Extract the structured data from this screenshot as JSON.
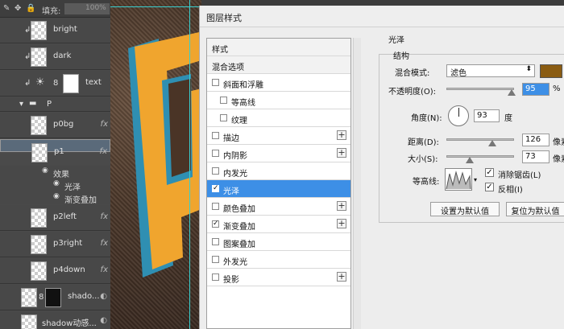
{
  "layers_panel": {
    "fill_label": "填充:",
    "fill_value": "100%",
    "layers": [
      {
        "name": "bright",
        "fx": ""
      },
      {
        "name": "dark",
        "fx": ""
      },
      {
        "name": "text",
        "fx": ""
      },
      {
        "name": "P",
        "fx": ""
      },
      {
        "name": "p0bg",
        "fx": "fx"
      },
      {
        "name": "p1",
        "fx": "fx"
      },
      {
        "name": "p2left",
        "fx": "fx"
      },
      {
        "name": "p3right",
        "fx": "fx"
      },
      {
        "name": "p4down",
        "fx": "fx"
      },
      {
        "name": "shado...",
        "fx": ""
      },
      {
        "name": "shadow动感...",
        "fx": ""
      }
    ],
    "effects_label": "效果",
    "effects": [
      "光泽",
      "渐变叠加"
    ]
  },
  "dialog": {
    "title": "图层样式",
    "styles_list": [
      {
        "label": "样式",
        "checkbox": false,
        "checked": false,
        "plus": false
      },
      {
        "label": "混合选项",
        "checkbox": false,
        "checked": false,
        "plus": false
      },
      {
        "label": "斜面和浮雕",
        "checkbox": true,
        "checked": false,
        "plus": false
      },
      {
        "label": "等高线",
        "checkbox": true,
        "checked": false,
        "plus": false
      },
      {
        "label": "纹理",
        "checkbox": true,
        "checked": false,
        "plus": false
      },
      {
        "label": "描边",
        "checkbox": true,
        "checked": false,
        "plus": true
      },
      {
        "label": "内阴影",
        "checkbox": true,
        "checked": false,
        "plus": true
      },
      {
        "label": "内发光",
        "checkbox": true,
        "checked": false,
        "plus": false
      },
      {
        "label": "光泽",
        "checkbox": true,
        "checked": true,
        "plus": false
      },
      {
        "label": "颜色叠加",
        "checkbox": true,
        "checked": false,
        "plus": true
      },
      {
        "label": "渐变叠加",
        "checkbox": true,
        "checked": true,
        "plus": true
      },
      {
        "label": "图案叠加",
        "checkbox": true,
        "checked": false,
        "plus": false
      },
      {
        "label": "外发光",
        "checkbox": true,
        "checked": false,
        "plus": false
      },
      {
        "label": "投影",
        "checkbox": true,
        "checked": false,
        "plus": true
      }
    ],
    "active_style": "光泽",
    "section_title": "光泽",
    "group_title": "结构",
    "blend_mode_label": "混合模式:",
    "blend_mode_value": "滤色",
    "blend_color": "#8a5c12",
    "opacity_label": "不透明度(O):",
    "opacity_value": "95",
    "opacity_unit": "%",
    "angle_label": "角度(N):",
    "angle_value": "93",
    "angle_unit": "度",
    "distance_label": "距离(D):",
    "distance_value": "126",
    "distance_unit": "像素",
    "size_label": "大小(S):",
    "size_value": "73",
    "size_unit": "像素",
    "contour_label": "等高线:",
    "antialias_label": "消除锯齿(L)",
    "invert_label": "反相(I)",
    "btn_default": "设置为默认值",
    "btn_reset": "复位为默认值"
  }
}
